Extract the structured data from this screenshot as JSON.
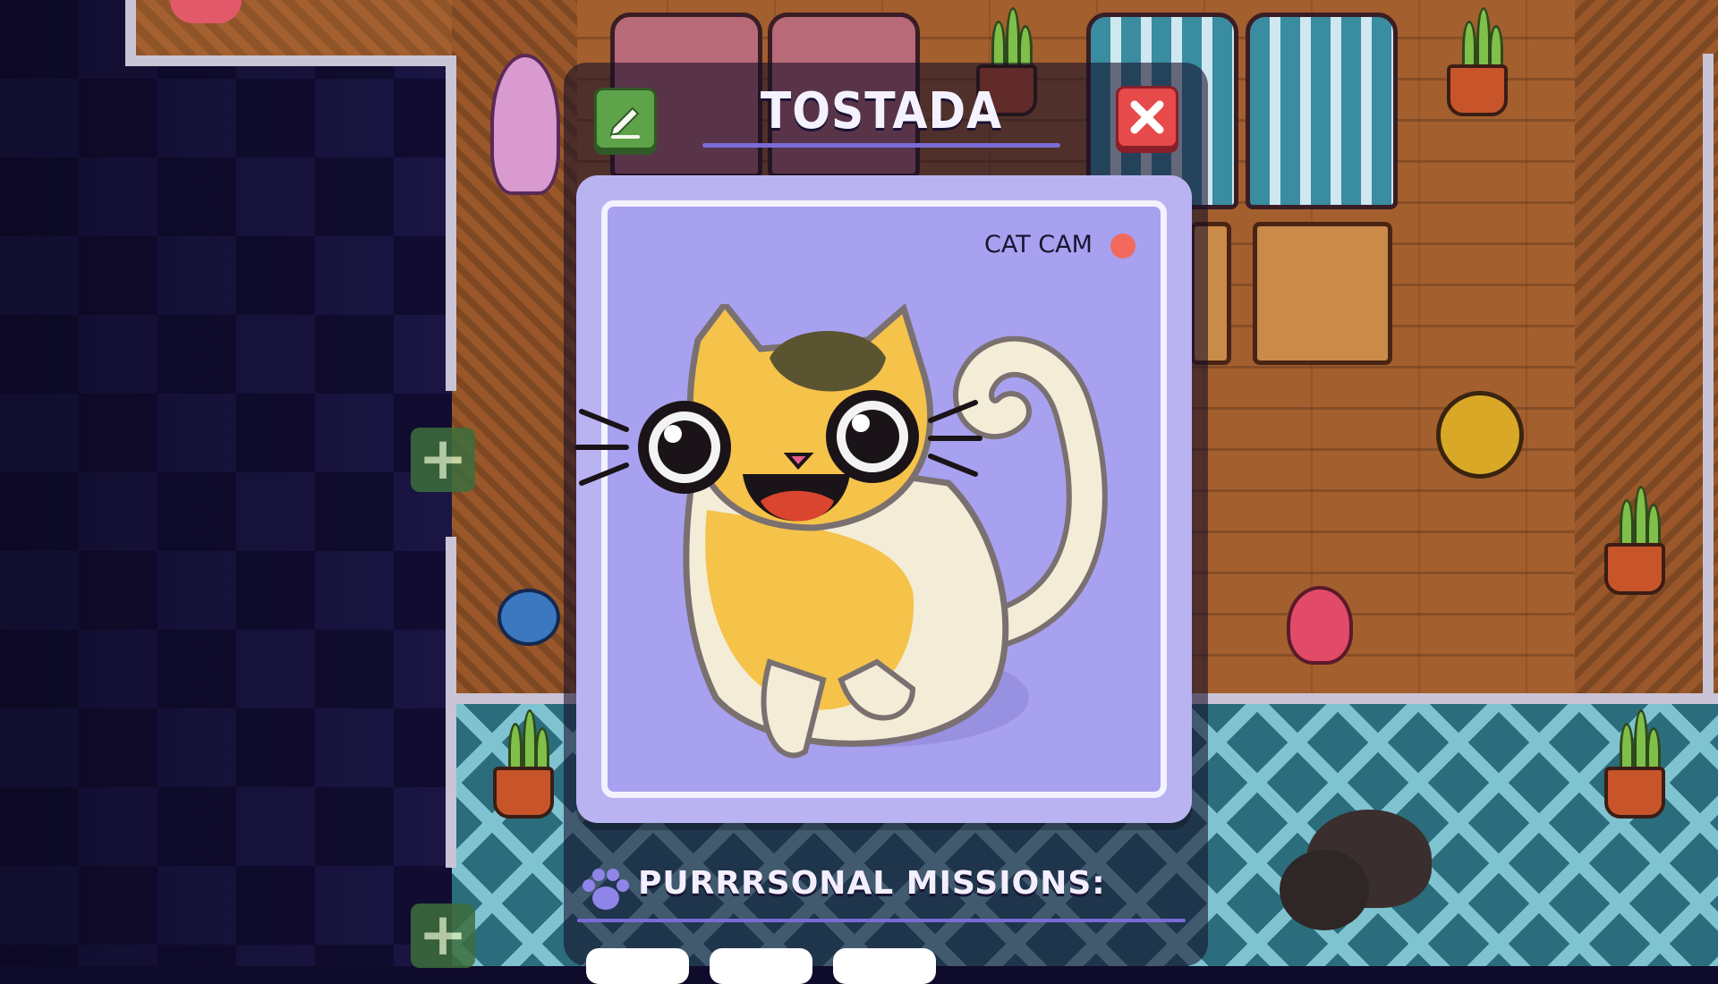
{
  "modal": {
    "cat_name": "TOSTADA",
    "edit_icon": "pencil-icon",
    "close_icon": "close-x-icon",
    "camera_label": "CAT CAM",
    "recording_indicator_color": "#f26a5e",
    "missions_label": "PURRRSONAL MISSIONS:",
    "missions_icon": "paw-icon"
  },
  "world": {
    "add_buttons": [
      {
        "label": "+"
      },
      {
        "label": "+"
      }
    ]
  },
  "colors": {
    "edit_button": "#5ea34a",
    "close_button": "#e64a4a",
    "cam_panel": "#bab3f2",
    "title_text": "#f5f2ff"
  }
}
